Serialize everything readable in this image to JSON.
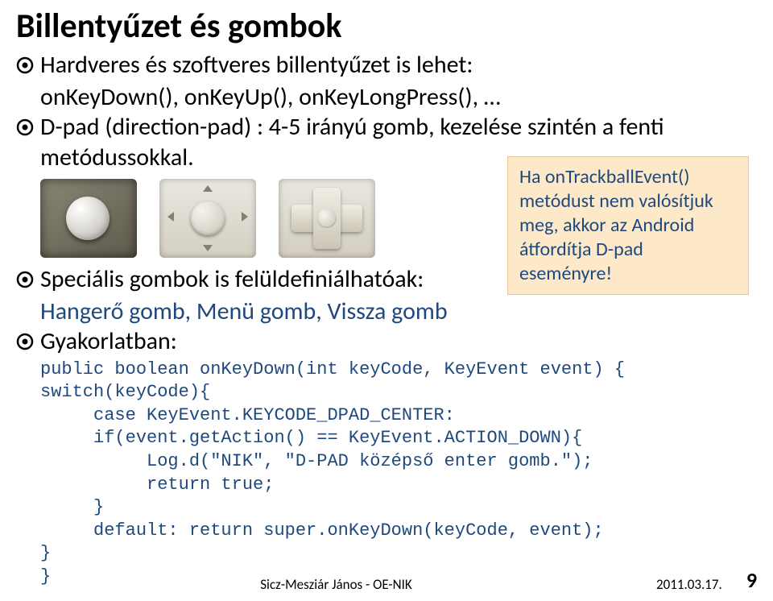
{
  "title": "Billentyűzet és gombok",
  "bullets": {
    "b1": "Hardveres és szoftveres billentyűzet is lehet:",
    "b1_sub": "onKeyDown(), onKeyUp(), onKeyLongPress(), …",
    "b2": "D-pad (direction-pad) : 4-5 irányú gomb, kezelése szintén a fenti metódussokkal.",
    "b3": "Speciális gombok is felüldefiniálhatóak:",
    "b3_sub": "Hangerő gomb, Menü gomb, Vissza gomb",
    "b4": "Gyakorlatban:"
  },
  "callout": "Ha onTrackballEvent() metódust nem valósítjuk meg, akkor az Android átfordítja D-pad eseményre!",
  "code": "public boolean onKeyDown(int keyCode, KeyEvent event) {\nswitch(keyCode){\n     case KeyEvent.KEYCODE_DPAD_CENTER:\n     if(event.getAction() == KeyEvent.ACTION_DOWN){\n          Log.d(\"NIK\", \"D-PAD középső enter gomb.\");\n          return true;\n     }\n     default: return super.onKeyDown(keyCode, event);\n}\n}",
  "footer": {
    "author": "Sicz-Mesziár János - OE-NIK",
    "date": "2011.03.17.",
    "page": "9"
  }
}
